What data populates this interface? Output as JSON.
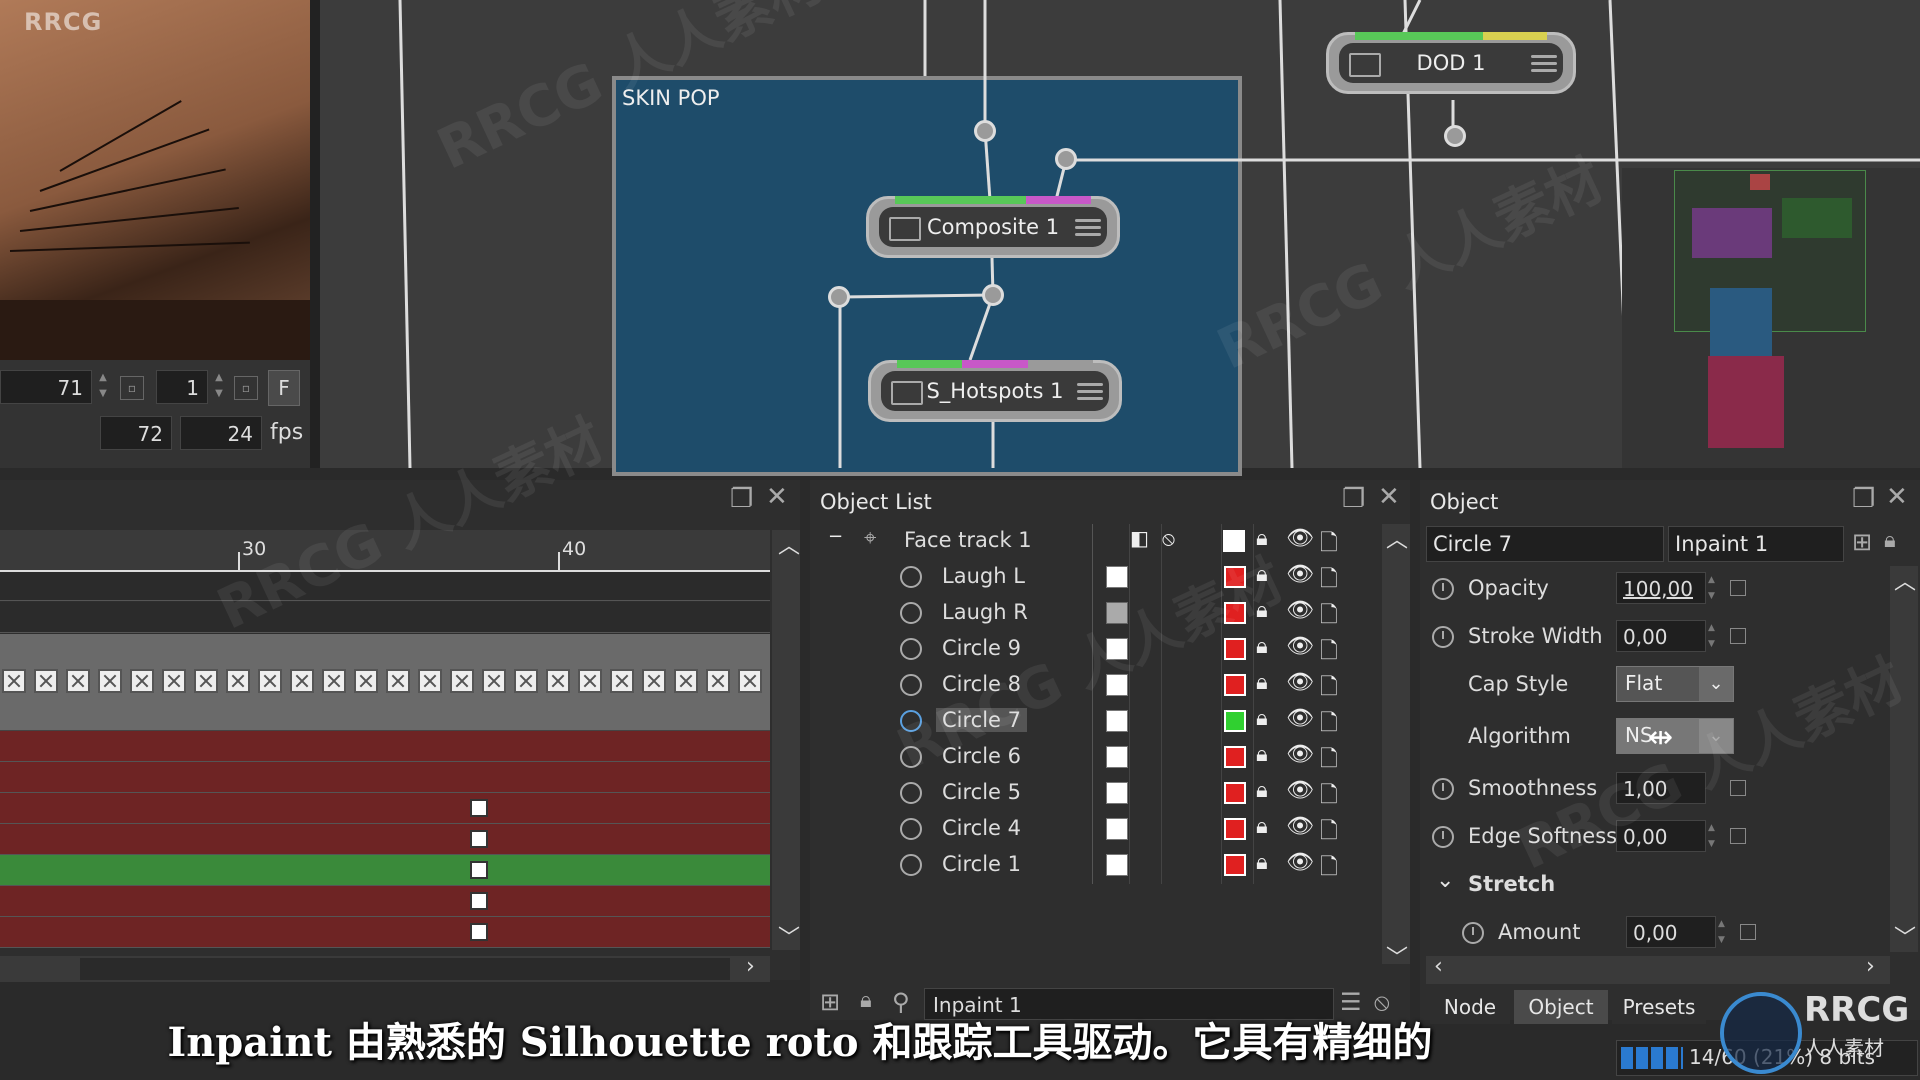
{
  "corner_logo": "RRCG",
  "viewer": {
    "frame_current": "71",
    "frame_step": "1",
    "f_button": "F",
    "frame_end": "72",
    "fps_value": "24",
    "fps_unit": "fps"
  },
  "nodegraph": {
    "group_title": "SKIN POP",
    "nodes": {
      "dod": "DOD 1",
      "composite": "Composite 1",
      "hotspots": "S_Hotspots 1"
    }
  },
  "timeline": {
    "ticks": [
      "30",
      "40"
    ]
  },
  "object_list": {
    "title": "Object List",
    "root": "Face track 1",
    "items": [
      {
        "label": "Laugh L",
        "color": "red",
        "swatch": "white"
      },
      {
        "label": "Laugh R",
        "color": "red",
        "swatch": "grey"
      },
      {
        "label": "Circle 9",
        "color": "red",
        "swatch": "white"
      },
      {
        "label": "Circle 8",
        "color": "red",
        "swatch": "white"
      },
      {
        "label": "Circle 7",
        "color": "green",
        "swatch": "white"
      },
      {
        "label": "Circle 6",
        "color": "red",
        "swatch": "white"
      },
      {
        "label": "Circle 5",
        "color": "red",
        "swatch": "white"
      },
      {
        "label": "Circle 4",
        "color": "red",
        "swatch": "white"
      },
      {
        "label": "Circle 1",
        "color": "red",
        "swatch": "white"
      }
    ],
    "footer_field": "Inpaint 1"
  },
  "object_panel": {
    "title": "Object",
    "object_name": "Circle 7",
    "node_name": "Inpaint 1",
    "props": {
      "opacity_label": "Opacity",
      "opacity_value": "100,00",
      "stroke_label": "Stroke Width",
      "stroke_value": "0,00",
      "cap_label": "Cap Style",
      "cap_value": "Flat",
      "algo_label": "Algorithm",
      "algo_value": "NS",
      "smooth_label": "Smoothness",
      "smooth_value": "1,00",
      "edge_label": "Edge Softness",
      "edge_value": "0,00",
      "stretch_label": "Stretch",
      "amount_label": "Amount",
      "amount_value": "0,00"
    },
    "tabs": [
      "Node",
      "Object",
      "Presets"
    ]
  },
  "status": {
    "text": "14/60 (21%) 8 bits"
  },
  "logo": {
    "brand": "RRCG",
    "sub": "人人素材"
  },
  "subtitle": "Inpaint 由熟悉的 Silhouette roto 和跟踪工具驱动。它具有精细的",
  "watermark": "RRCG 人人素材"
}
